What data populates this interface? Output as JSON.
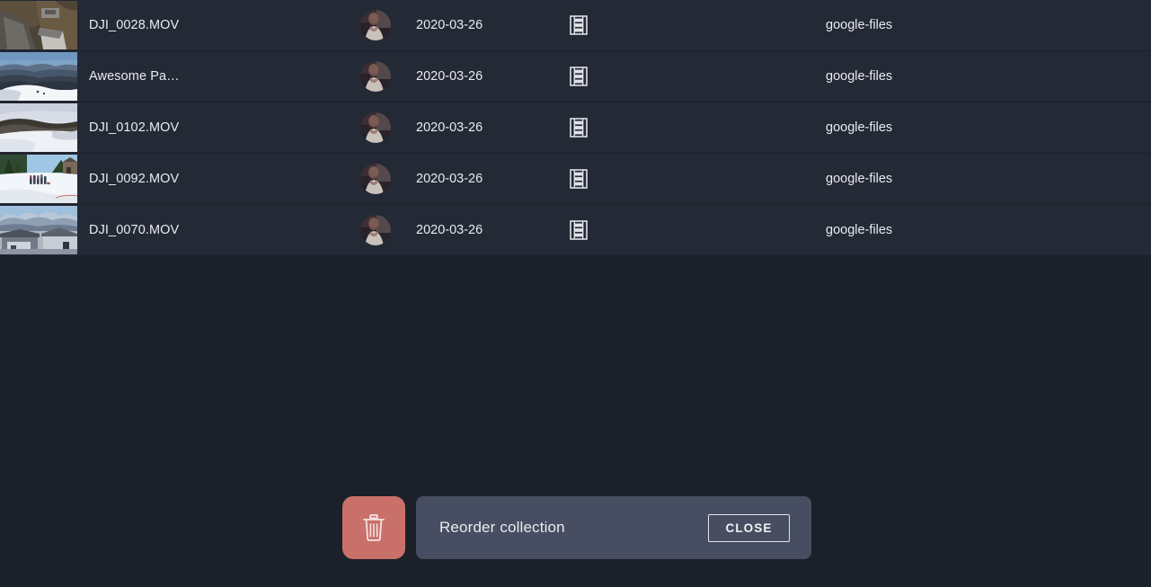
{
  "theme": {
    "page_background": "#1c2029",
    "row_background": "#242936",
    "row_divider": "#1d2029",
    "text_primary": "#e9ebef",
    "snackbar_background": "#474e61",
    "delete_button_background": "#c9706a",
    "close_button_border": "#e3e5ea"
  },
  "list": {
    "columns": [
      "thumbnail",
      "name",
      "owner",
      "date",
      "type",
      "source"
    ],
    "rows": [
      {
        "name": "DJI_0028.MOV",
        "date": "2020-03-26",
        "source": "google-files",
        "type_icon": "film-strip-icon",
        "owner_icon": "avatar",
        "thumbnail": "aerial-road-buildings-forest"
      },
      {
        "name": "Awesome Pa…",
        "date": "2020-03-26",
        "source": "google-files",
        "type_icon": "film-strip-icon",
        "owner_icon": "avatar",
        "thumbnail": "snowy-mountain-ridge-panorama"
      },
      {
        "name": "DJI_0102.MOV",
        "date": "2020-03-26",
        "source": "google-files",
        "type_icon": "film-strip-icon",
        "owner_icon": "avatar",
        "thumbnail": "snow-field-dark-stream"
      },
      {
        "name": "DJI_0092.MOV",
        "date": "2020-03-26",
        "source": "google-files",
        "type_icon": "film-strip-icon",
        "owner_icon": "avatar",
        "thumbnail": "people-standing-on-snow-field"
      },
      {
        "name": "DJI_0070.MOV",
        "date": "2020-03-26",
        "source": "google-files",
        "type_icon": "film-strip-icon",
        "owner_icon": "avatar",
        "thumbnail": "houses-with-mountain-range"
      }
    ]
  },
  "snackbar": {
    "message": "Reorder collection",
    "close_label": "CLOSE",
    "delete_icon": "trash-icon"
  }
}
